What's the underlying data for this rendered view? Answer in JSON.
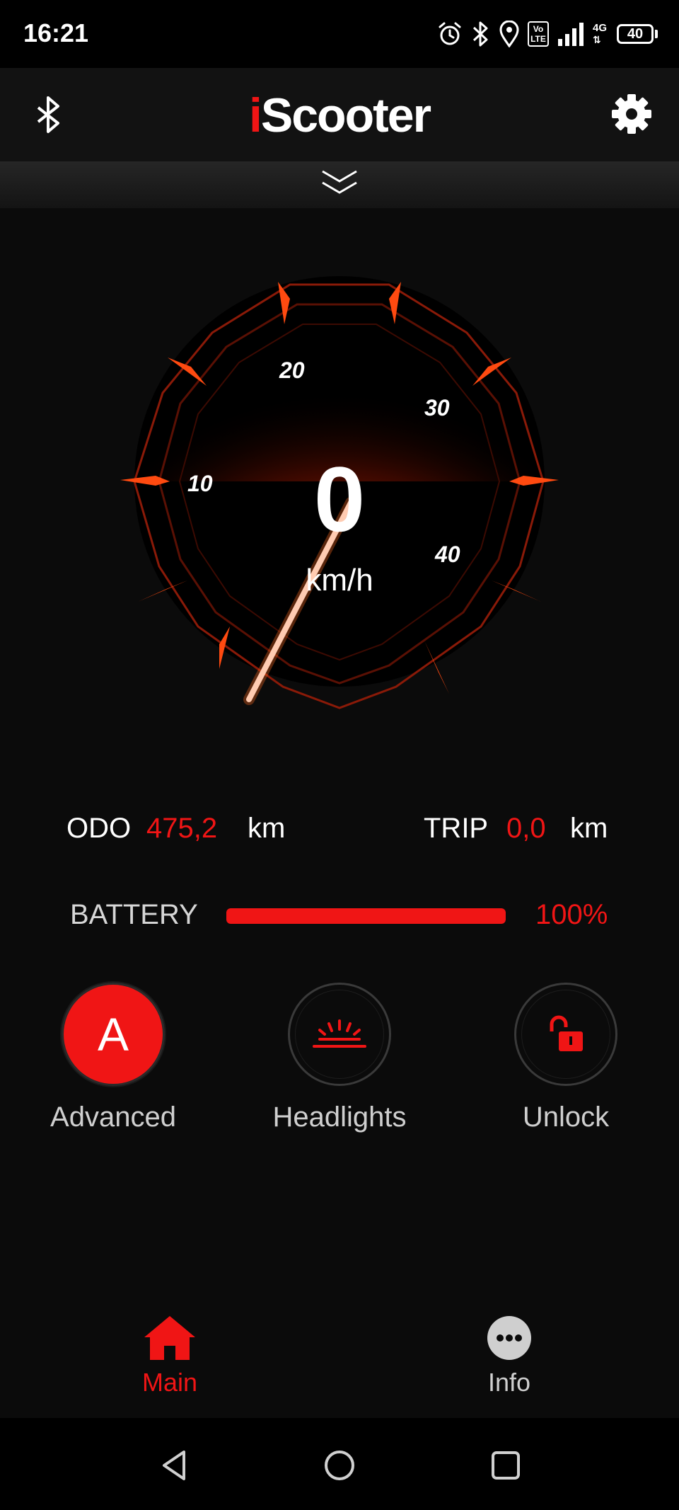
{
  "status_bar": {
    "time": "16:21",
    "battery_level": "40",
    "icons": [
      "alarm-icon",
      "bluetooth-icon",
      "location-icon",
      "volte-icon",
      "signal-icon",
      "4g-icon",
      "battery-icon"
    ],
    "volte_label": "Vo LTE",
    "network_label": "4G"
  },
  "app_bar": {
    "logo_i": "i",
    "logo_rest": "Scooter",
    "left_icon": "bluetooth-icon",
    "right_icon": "gear-icon"
  },
  "speedometer": {
    "speed": "0",
    "unit": "km/h",
    "tick_labels": [
      "10",
      "20",
      "30",
      "40"
    ],
    "needle_value": 0
  },
  "stats": {
    "odo_label": "ODO",
    "odo_value": "475,2",
    "odo_unit": "km",
    "trip_label": "TRIP",
    "trip_value": "0,0",
    "trip_unit": "km"
  },
  "battery": {
    "label": "BATTERY",
    "percent_text": "100%",
    "level_fraction": 1.0
  },
  "controls": [
    {
      "letter": "A",
      "label": "Advanced",
      "active": true
    },
    {
      "label": "Headlights",
      "active": false,
      "icon": "headlight-icon"
    },
    {
      "label": "Unlock",
      "active": false,
      "icon": "unlock-icon"
    }
  ],
  "bottom_nav": [
    {
      "label": "Main",
      "icon": "home-icon",
      "active": true
    },
    {
      "label": "Info",
      "icon": "more-icon",
      "active": false
    }
  ],
  "colors": {
    "accent": "#f01515",
    "background": "#0b0b0b",
    "inactive_text": "#cfcfcf"
  }
}
